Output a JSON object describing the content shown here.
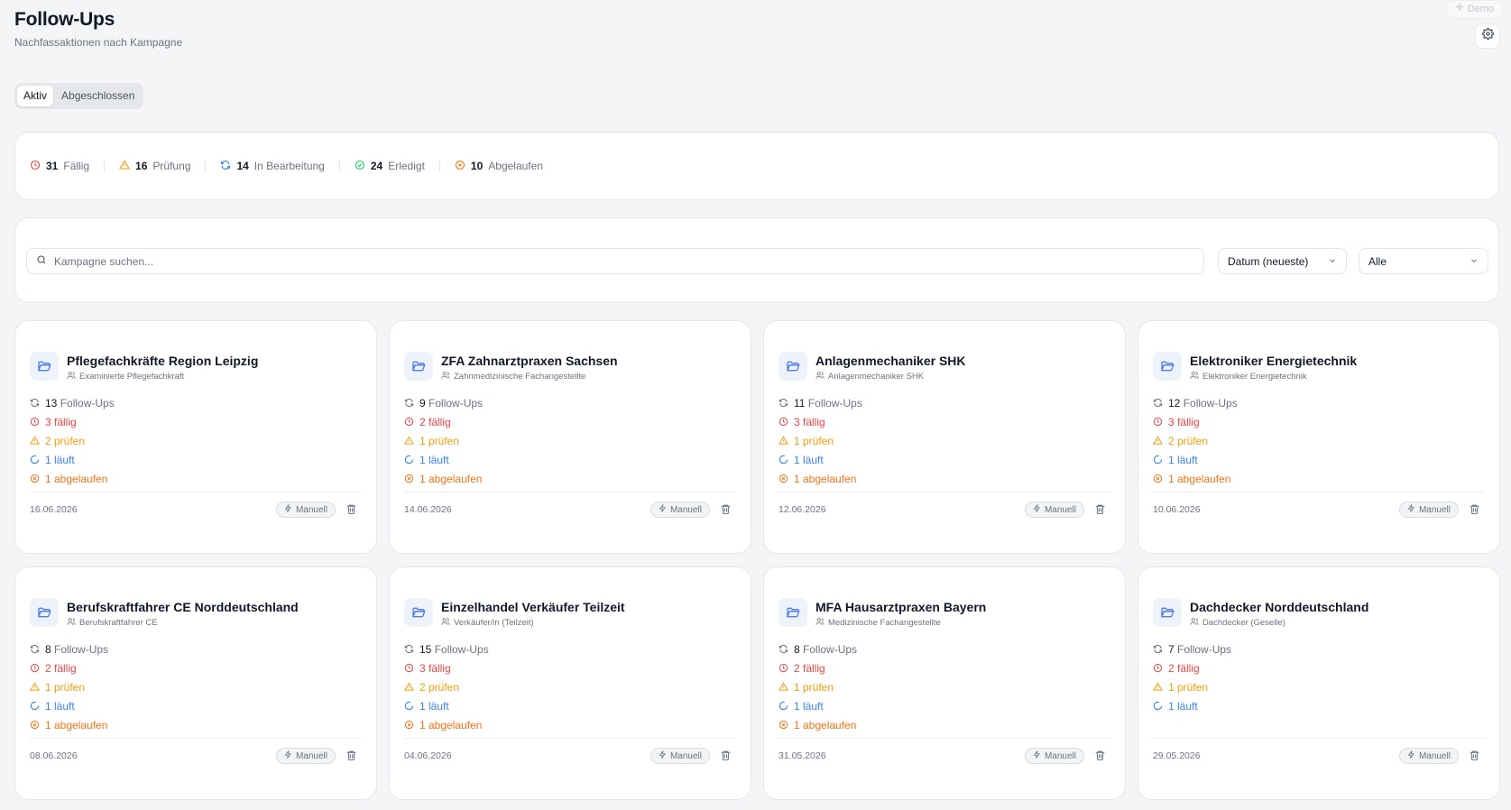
{
  "header": {
    "title": "Follow-Ups",
    "subtitle": "Nachfassaktionen nach Kampagne",
    "demo_label": "Demo"
  },
  "tabs": [
    {
      "label": "Aktiv",
      "active": true
    },
    {
      "label": "Abgeschlossen",
      "active": false
    }
  ],
  "stats": [
    {
      "value": "31",
      "label": "Fällig",
      "icon": "clock-icon",
      "color": "#ef4444"
    },
    {
      "value": "16",
      "label": "Prüfung",
      "icon": "warning-icon",
      "color": "#f59e0b"
    },
    {
      "value": "14",
      "label": "In Bearbeitung",
      "icon": "refresh-icon",
      "color": "#3b82f6"
    },
    {
      "value": "24",
      "label": "Erledigt",
      "icon": "check-circle-icon",
      "color": "#22c55e"
    },
    {
      "value": "10",
      "label": "Abgelaufen",
      "icon": "x-circle-icon",
      "color": "#f97316"
    }
  ],
  "filters": {
    "search_placeholder": "Kampagne suchen...",
    "sort_value": "Datum (neueste)",
    "filter_value": "Alle"
  },
  "colors": {
    "due": "#ef4444",
    "review": "#f59e0b",
    "running": "#3b82f6",
    "done": "#22c55e",
    "expired": "#f97316",
    "accent": "#4f7df0"
  },
  "cards": [
    {
      "title": "Pflegefachkräfte Region Leipzig",
      "role": "Examinierte Pflegefachkraft",
      "total": "13",
      "total_label": "Follow-Ups",
      "due": "3 fällig",
      "review": "2 prüfen",
      "running": "1 läuft",
      "expired": "1 abgelaufen",
      "date": "16.06.2026",
      "mode": "Manuell"
    },
    {
      "title": "ZFA Zahnarztpraxen Sachsen",
      "role": "Zahnmedizinische Fachangestellte",
      "total": "9",
      "total_label": "Follow-Ups",
      "due": "2 fällig",
      "review": "1 prüfen",
      "running": "1 läuft",
      "expired": "1 abgelaufen",
      "date": "14.06.2026",
      "mode": "Manuell"
    },
    {
      "title": "Anlagenmechaniker SHK",
      "role": "Anlagenmechaniker SHK",
      "total": "11",
      "total_label": "Follow-Ups",
      "due": "3 fällig",
      "review": "1 prüfen",
      "running": "1 läuft",
      "expired": "1 abgelaufen",
      "date": "12.06.2026",
      "mode": "Manuell"
    },
    {
      "title": "Elektroniker Energietechnik",
      "role": "Elektroniker Energietechnik",
      "total": "12",
      "total_label": "Follow-Ups",
      "due": "3 fällig",
      "review": "2 prüfen",
      "running": "1 läuft",
      "expired": "1 abgelaufen",
      "date": "10.06.2026",
      "mode": "Manuell"
    },
    {
      "title": "Berufskraftfahrer CE Norddeutschland",
      "role": "Berufskraftfahrer CE",
      "total": "8",
      "total_label": "Follow-Ups",
      "due": "2 fällig",
      "review": "1 prüfen",
      "running": "1 läuft",
      "expired": "1 abgelaufen",
      "date": "08.06.2026",
      "mode": "Manuell"
    },
    {
      "title": "Einzelhandel Verkäufer Teilzeit",
      "role": "Verkäufer/in (Teilzeit)",
      "total": "15",
      "total_label": "Follow-Ups",
      "due": "3 fällig",
      "review": "2 prüfen",
      "running": "1 läuft",
      "expired": "1 abgelaufen",
      "date": "04.06.2026",
      "mode": "Manuell"
    },
    {
      "title": "MFA Hausarztpraxen Bayern",
      "role": "Medizinische Fachangestellte",
      "total": "8",
      "total_label": "Follow-Ups",
      "due": "2 fällig",
      "review": "1 prüfen",
      "running": "1 läuft",
      "expired": "1 abgelaufen",
      "date": "31.05.2026",
      "mode": "Manuell"
    },
    {
      "title": "Dachdecker Norddeutschland",
      "role": "Dachdecker (Geselle)",
      "total": "7",
      "total_label": "Follow-Ups",
      "due": "2 fällig",
      "review": "1 prüfen",
      "running": "1 läuft",
      "expired": null,
      "date": "29.05.2026",
      "mode": "Manuell"
    }
  ]
}
